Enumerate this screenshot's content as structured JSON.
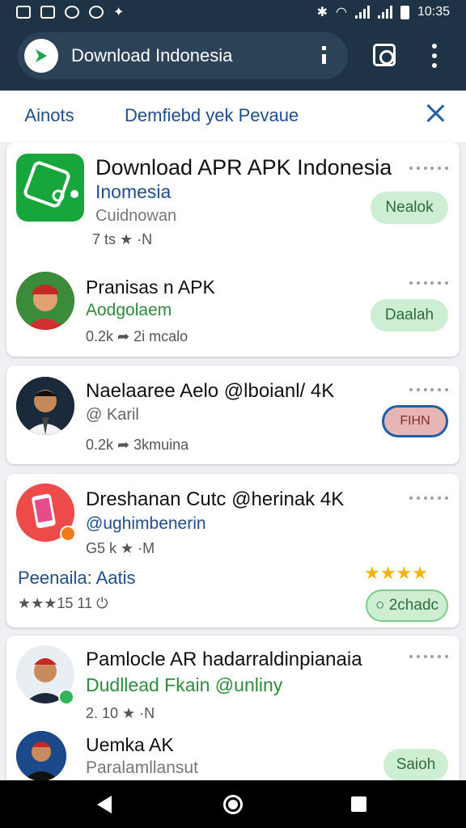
{
  "status_bar": {
    "time": "10:35"
  },
  "browser": {
    "url_text": "Download Indonesia"
  },
  "tabs": {
    "active_label": "Ainots",
    "second_label": "Demfiebd yek Pevaue"
  },
  "cards": [
    {
      "items": [
        {
          "title": "Download APR APK Indonesia",
          "subtitle": "Inomesia",
          "category": "Cuidnowan",
          "meta": "7 ts ★ ·N",
          "button": "Nealok"
        },
        {
          "title": "Pranisas n APK",
          "subtitle": "Aodgolaem",
          "meta": "0.2k ➦ 2i mcalo",
          "button": "Daalah"
        }
      ]
    },
    {
      "items": [
        {
          "title": "Naelaaree Aelo @lboianl/ 4K",
          "subtitle": "@ Karil",
          "meta": "0.2k ➦ 3kmuina",
          "button": "FIHN"
        }
      ]
    },
    {
      "items": [
        {
          "title": "Dreshanan Cutc @herinak 4K",
          "subtitle": "@ughimbenerin",
          "meta": "G5 k ★ ·M",
          "promo": "Peenaila: Aatis",
          "stars_left": "★★★15  11 ⏻",
          "stars_right": "★★★★",
          "button": "○ 2chadc"
        }
      ]
    },
    {
      "items": [
        {
          "title": "Pamlocle AR hadarraldinpianaia",
          "subtitle": "Dudllead Fkain @unliny",
          "meta": "2. 10 ★ ·N"
        },
        {
          "title": "Uemka AK",
          "subtitle": "Paralamllansut",
          "button": "Saioh"
        }
      ]
    }
  ]
}
